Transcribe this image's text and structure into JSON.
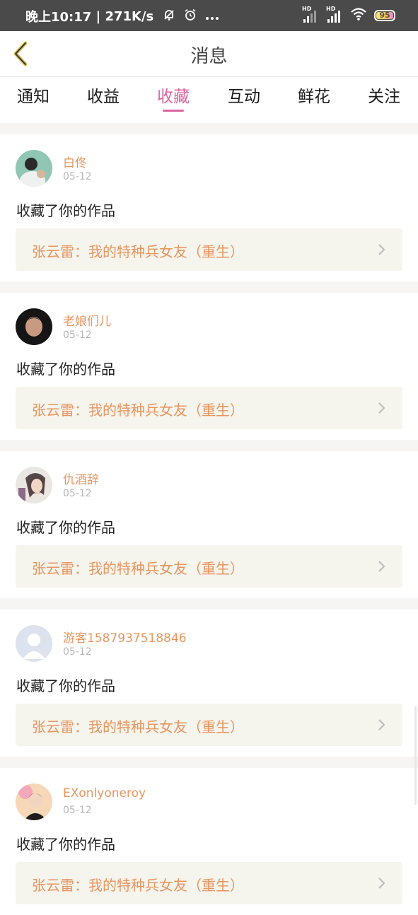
{
  "status_bar": {
    "time": "晚上10:17",
    "speed": "271K/s",
    "battery": "95",
    "signal1": "HD",
    "signal2": "HD"
  },
  "header": {
    "title": "消息"
  },
  "tabs": [
    {
      "label": "通知"
    },
    {
      "label": "收益"
    },
    {
      "label": "收藏"
    },
    {
      "label": "互动"
    },
    {
      "label": "鲜花"
    },
    {
      "label": "关注"
    }
  ],
  "active_tab": "收藏",
  "colors": {
    "accent": "#d9669e",
    "name": "#e8955f",
    "card_bg": "#f5f4ed"
  },
  "items": [
    {
      "user": "白佟",
      "date": "05-12",
      "action": "收藏了你的作品",
      "work": "张云雷：我的特种兵女友（重生）"
    },
    {
      "user": "老娘们儿",
      "date": "05-12",
      "action": "收藏了你的作品",
      "work": "张云雷：我的特种兵女友（重生）"
    },
    {
      "user": "仇酒辞",
      "date": "05-12",
      "action": "收藏了你的作品",
      "work": "张云雷：我的特种兵女友（重生）"
    },
    {
      "user": "游客1587937518846",
      "date": "05-12",
      "action": "收藏了你的作品",
      "work": "张云雷：我的特种兵女友（重生）"
    },
    {
      "user": "EXonlyoneroy",
      "date": "05-12",
      "action": "收藏了你的作品",
      "work": "张云雷：我的特种兵女友（重生）"
    }
  ]
}
